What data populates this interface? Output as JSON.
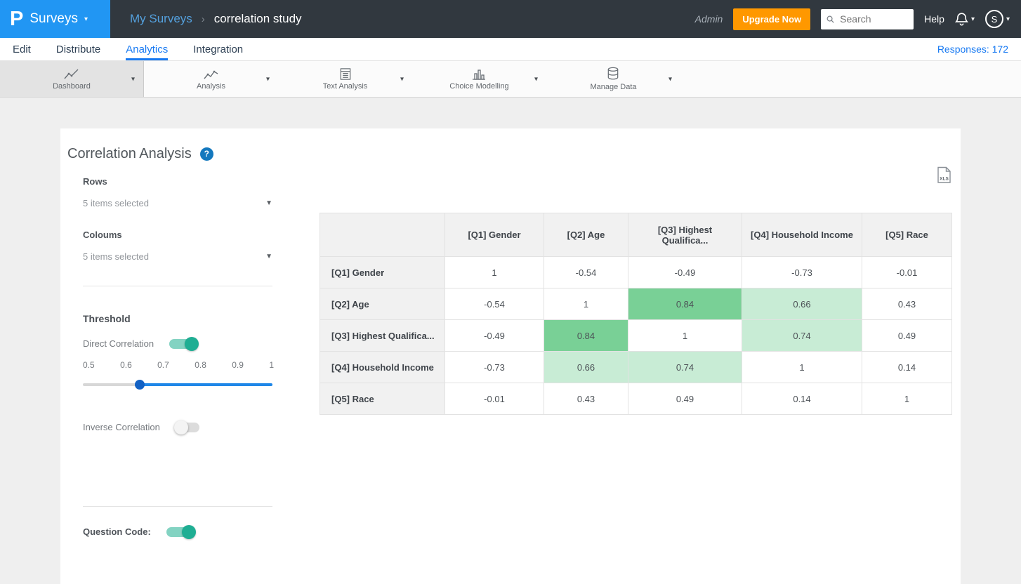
{
  "header": {
    "logo": "P",
    "product": "Surveys",
    "breadcrumb": {
      "parent": "My Surveys",
      "separator": "›",
      "current": "correlation study"
    },
    "admin_label": "Admin",
    "upgrade_button": "Upgrade Now",
    "search_placeholder": "Search",
    "help_label": "Help",
    "avatar_initial": "S"
  },
  "tabs": {
    "items": [
      {
        "label": "Edit",
        "active": false
      },
      {
        "label": "Distribute",
        "active": false
      },
      {
        "label": "Analytics",
        "active": true
      },
      {
        "label": "Integration",
        "active": false
      }
    ],
    "responses_label": "Responses: 172"
  },
  "toolbar": {
    "items": [
      {
        "label": "Dashboard",
        "icon": "line-chart-icon",
        "selected": true
      },
      {
        "label": "Analysis",
        "icon": "line-chart-icon",
        "selected": false
      },
      {
        "label": "Text Analysis",
        "icon": "text-document-icon",
        "selected": false
      },
      {
        "label": "Choice Modelling",
        "icon": "bar-chart-icon",
        "selected": false
      },
      {
        "label": "Manage Data",
        "icon": "database-icon",
        "selected": false
      }
    ]
  },
  "panel": {
    "title": "Correlation Analysis",
    "help_badge": "?",
    "rows_label": "Rows",
    "rows_value": "5 items selected",
    "columns_label": "Coloums",
    "columns_value": "5 items selected",
    "threshold": {
      "label": "Threshold",
      "direct_label": "Direct Correlation",
      "direct_on": true,
      "scale": [
        "0.5",
        "0.6",
        "0.7",
        "0.8",
        "0.9",
        "1"
      ],
      "slider_value": 0.65,
      "inverse_label": "Inverse Correlation",
      "inverse_on": false
    },
    "question_code_label": "Question Code:",
    "question_code_on": true,
    "export_label": "XLS"
  },
  "chart_data": {
    "type": "heatmap",
    "title": "Correlation Analysis",
    "columns": [
      "[Q1] Gender",
      "[Q2] Age",
      "[Q3] Highest Qualifica...",
      "[Q4] Household Income",
      "[Q5] Race"
    ],
    "rows": [
      "[Q1] Gender",
      "[Q2] Age",
      "[Q3] Highest Qualifica...",
      "[Q4] Household Income",
      "[Q5] Race"
    ],
    "values": [
      [
        1,
        -0.54,
        -0.49,
        -0.73,
        -0.01
      ],
      [
        -0.54,
        1,
        0.84,
        0.66,
        0.43
      ],
      [
        -0.49,
        0.84,
        1,
        0.74,
        0.49
      ],
      [
        -0.73,
        0.66,
        0.74,
        1,
        0.14
      ],
      [
        -0.01,
        0.43,
        0.49,
        0.14,
        1
      ]
    ],
    "highlight": {
      "threshold": 0.65,
      "strong": 0.8,
      "light_color": "#c8ecd5",
      "strong_color": "#79d096"
    }
  }
}
